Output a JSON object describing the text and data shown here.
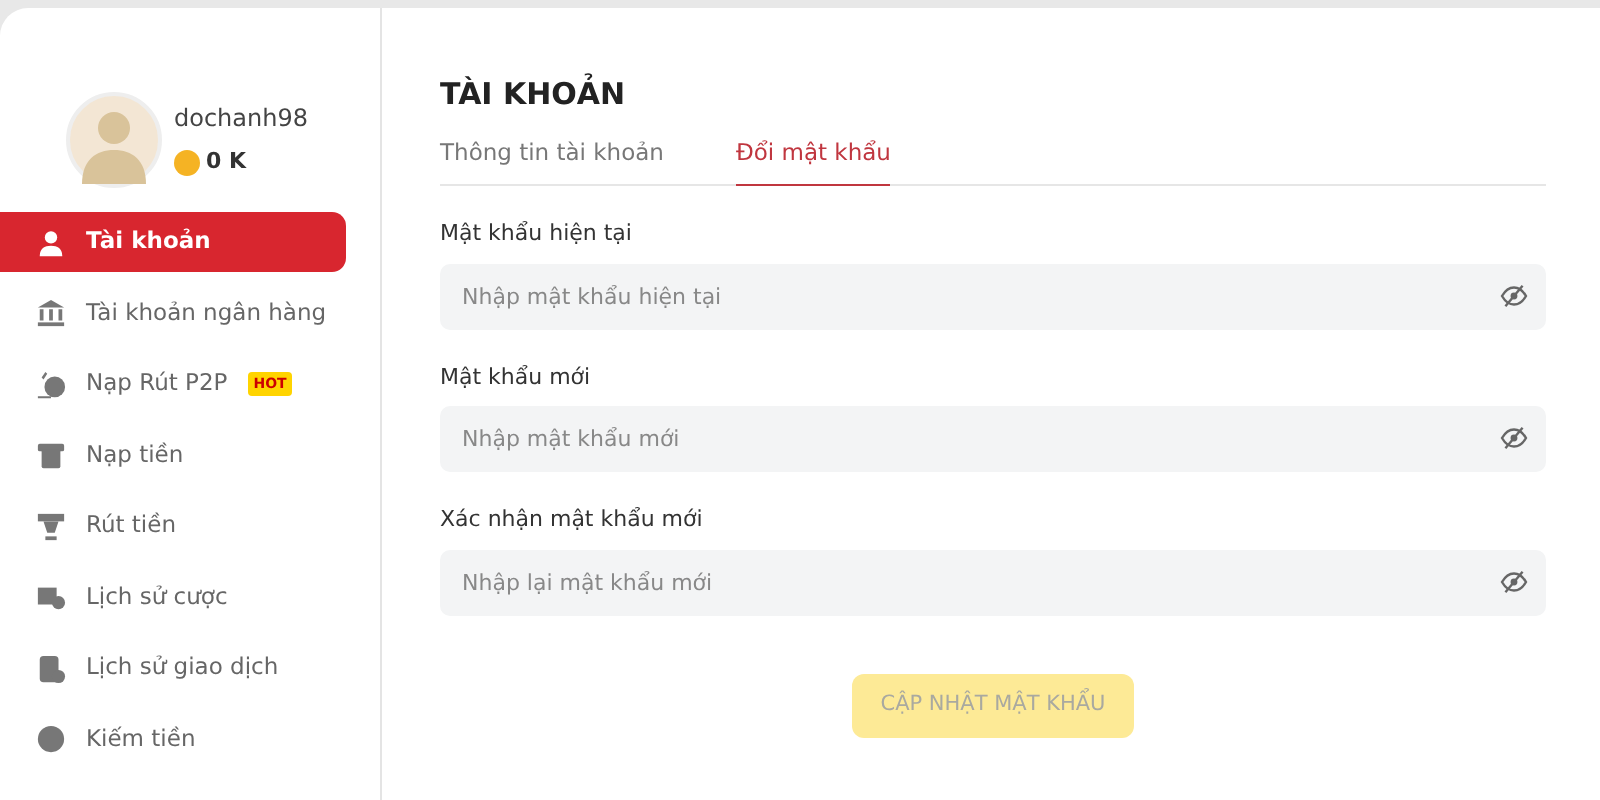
{
  "sidebar": {
    "user": {
      "username": "dochanh98",
      "balance": "0 K"
    },
    "items": [
      {
        "label": "Tài khoản",
        "selected": true
      },
      {
        "label": "Tài khoản ngân hàng",
        "selected": false
      },
      {
        "label": "Nạp Rút P2P",
        "selected": false,
        "badge": "HOT"
      },
      {
        "label": "Nạp tiền",
        "selected": false
      },
      {
        "label": "Rút tiền",
        "selected": false
      },
      {
        "label": "Lịch sử cược",
        "selected": false
      },
      {
        "label": "Lịch sử giao dịch",
        "selected": false
      },
      {
        "label": "Kiếm tiền",
        "selected": false
      }
    ]
  },
  "main": {
    "title": "TÀI KHOẢN",
    "tabs": [
      {
        "label": "Thông tin tài khoản",
        "selected": false
      },
      {
        "label": "Đổi mật khẩu",
        "selected": true
      }
    ],
    "fields": [
      {
        "label": "Mật khẩu hiện tại",
        "placeholder": "Nhập mật khẩu hiện tại"
      },
      {
        "label": "Mật khẩu mới",
        "placeholder": "Nhập mật khẩu mới"
      },
      {
        "label": "Xác nhận mật khẩu mới",
        "placeholder": "Nhập lại mật khẩu mới"
      }
    ],
    "button": {
      "label": "CẬP NHẬT MẬT KHẨU",
      "disabled": true
    }
  }
}
